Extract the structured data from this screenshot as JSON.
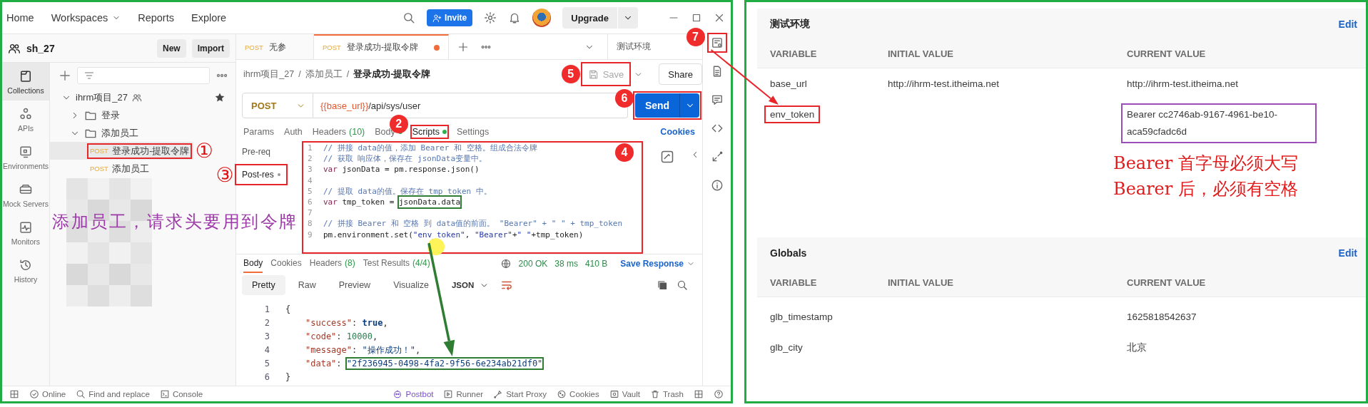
{
  "top_bar": {
    "nav": [
      {
        "label": "Home",
        "dropdown": false
      },
      {
        "label": "Workspaces",
        "dropdown": true
      },
      {
        "label": "Reports",
        "dropdown": false
      },
      {
        "label": "Explore",
        "dropdown": false
      }
    ],
    "invite": "Invite",
    "upgrade": "Upgrade"
  },
  "workspace": {
    "name": "sh_27",
    "buttons": [
      "New",
      "Import"
    ]
  },
  "rail": [
    {
      "label": "Collections",
      "kind": "collections",
      "selected": true
    },
    {
      "label": "APIs",
      "kind": "apis",
      "selected": false
    },
    {
      "label": "Environments",
      "kind": "environments",
      "selected": false
    },
    {
      "label": "Mock Servers",
      "kind": "mock",
      "selected": false
    },
    {
      "label": "Monitors",
      "kind": "monitors",
      "selected": false
    },
    {
      "label": "History",
      "kind": "history",
      "selected": false
    }
  ],
  "tree": [
    {
      "kind": "collection",
      "label": "ihrm项目_27",
      "expanded": true,
      "starred": true,
      "children": [
        {
          "kind": "folder",
          "label": "登录",
          "expanded": false
        },
        {
          "kind": "folder",
          "label": "添加员工",
          "expanded": true,
          "children": [
            {
              "kind": "request",
              "method": "POST",
              "label": "登录成功-提取令牌",
              "selected": true,
              "boxed": true,
              "marker": {
                "kind": "circled",
                "text": "①"
              }
            },
            {
              "kind": "request",
              "method": "POST",
              "label": "添加员工",
              "selected": false,
              "boxed": false
            }
          ]
        }
      ]
    }
  ],
  "note": "添加员工，请求头要用到令牌",
  "tabs": [
    {
      "method": "POST",
      "label": "无参",
      "selected": false,
      "unsaved": false
    },
    {
      "method": "POST",
      "label": "登录成功-提取令牌",
      "selected": true,
      "unsaved": true
    }
  ],
  "environment": "测试环境",
  "breadcrumb": {
    "items": [
      "ihrm项目_27",
      "添加员工",
      "登录成功-提取令牌"
    ],
    "separator": "/"
  },
  "request": {
    "method": "POST",
    "url_variable": "{{base_url}}",
    "url_path": "/api/sys/user",
    "save": {
      "label": "Save",
      "boxed": true,
      "marker": {
        "kind": "badge",
        "text": "5"
      }
    },
    "share": "Share",
    "send": {
      "label": "Send",
      "boxed": true,
      "marker": {
        "kind": "badge",
        "text": "6"
      }
    }
  },
  "request_tabs": [
    {
      "label": "Params",
      "selected": false,
      "dot": false,
      "boxed": false
    },
    {
      "label": "Auth",
      "selected": false,
      "dot": false,
      "boxed": false
    },
    {
      "label": "Headers",
      "count": "(10)",
      "selected": false,
      "dot": false,
      "boxed": false
    },
    {
      "label": "Body",
      "selected": false,
      "dot": true,
      "boxed": false
    },
    {
      "label": "Scripts",
      "selected": true,
      "dot": true,
      "boxed": true,
      "marker": {
        "kind": "badge",
        "text": "2"
      }
    },
    {
      "label": "Settings",
      "selected": false,
      "dot": false,
      "boxed": false
    }
  ],
  "cookies_link": "Cookies",
  "script_tabs": [
    {
      "label": "Pre-req",
      "selected": false,
      "dot": false,
      "boxed": false
    },
    {
      "label": "Post-res",
      "selected": true,
      "dot": true,
      "boxed": true,
      "marker": {
        "kind": "circled",
        "text": "③"
      }
    }
  ],
  "script": {
    "boxed": true,
    "marker": {
      "kind": "badge",
      "text": "4"
    },
    "lines": [
      {
        "number": "1",
        "segments": [
          {
            "kind": "comment",
            "text": "// 拼接 data的值，添加 Bearer 和 空格。组成合法令牌",
            "boxed": false
          }
        ]
      },
      {
        "number": "2",
        "segments": [
          {
            "kind": "comment",
            "text": "// 获取 响应体，保存在 jsonData变量中。",
            "boxed": false
          }
        ]
      },
      {
        "number": "3",
        "segments": [
          {
            "kind": "keyword",
            "text": "var",
            "boxed": false
          },
          {
            "kind": "plain",
            "text": " jsonData = pm.response.json()",
            "boxed": false
          }
        ]
      },
      {
        "number": "4"
      },
      {
        "number": "5",
        "segments": [
          {
            "kind": "comment",
            "text": "// 提取 data的值。保存在 tmp_token 中。",
            "boxed": false
          }
        ]
      },
      {
        "number": "6",
        "segments": [
          {
            "kind": "keyword",
            "text": "var",
            "boxed": false
          },
          {
            "kind": "plain",
            "text": " tmp_token = ",
            "boxed": false
          },
          {
            "kind": "plain",
            "text": "jsonData.data",
            "boxed": true
          }
        ]
      },
      {
        "number": "7"
      },
      {
        "number": "8",
        "segments": [
          {
            "kind": "comment",
            "text": "// 拼接 Bearer 和 空格 到 data值的前面。 \"Bearer\" + \" \" + tmp_token",
            "boxed": false
          }
        ]
      },
      {
        "number": "9",
        "segments": [
          {
            "kind": "plain",
            "text": "pm.environment.set(",
            "boxed": false
          },
          {
            "kind": "string",
            "text": "\"env_token\"",
            "boxed": false
          },
          {
            "kind": "plain",
            "text": ", ",
            "boxed": false
          },
          {
            "kind": "string",
            "text": "\"Bearer\"",
            "boxed": false
          },
          {
            "kind": "plain",
            "text": "+",
            "boxed": false
          },
          {
            "kind": "string",
            "text": "\" \"",
            "boxed": false
          },
          {
            "kind": "plain",
            "text": "+tmp_token)",
            "boxed": false
          }
        ]
      }
    ]
  },
  "response": {
    "tabs": [
      {
        "label": "Body",
        "selected": true
      },
      {
        "label": "Cookies",
        "selected": false
      },
      {
        "label": "Headers",
        "count": "(8)",
        "selected": false
      },
      {
        "label": "Test Results",
        "count": "(4/4)",
        "selected": false
      }
    ],
    "status": "200 OK",
    "time": "38 ms",
    "size": "410 B",
    "save_response": "Save Response",
    "views": [
      {
        "label": "Pretty",
        "selected": true
      },
      {
        "label": "Raw",
        "selected": false
      },
      {
        "label": "Preview",
        "selected": false
      },
      {
        "label": "Visualize",
        "selected": false
      }
    ],
    "format": "JSON",
    "lines": [
      {
        "number": "1",
        "indented": false,
        "segments": [
          {
            "kind": "punct",
            "text": "{",
            "boxed": false
          }
        ]
      },
      {
        "number": "2",
        "indented": true,
        "segments": [
          {
            "kind": "key",
            "text": "\"success\"",
            "boxed": false
          },
          {
            "kind": "punct",
            "text": ": ",
            "boxed": false
          },
          {
            "kind": "bool",
            "text": "true",
            "boxed": false
          },
          {
            "kind": "punct",
            "text": ",",
            "boxed": false
          }
        ]
      },
      {
        "number": "3",
        "indented": true,
        "segments": [
          {
            "kind": "key",
            "text": "\"code\"",
            "boxed": false
          },
          {
            "kind": "punct",
            "text": ": ",
            "boxed": false
          },
          {
            "kind": "number",
            "text": "10000",
            "boxed": false
          },
          {
            "kind": "punct",
            "text": ",",
            "boxed": false
          }
        ]
      },
      {
        "number": "4",
        "indented": true,
        "segments": [
          {
            "kind": "key",
            "text": "\"message\"",
            "boxed": false
          },
          {
            "kind": "punct",
            "text": ": ",
            "boxed": false
          },
          {
            "kind": "string",
            "text": "\"操作成功！\"",
            "boxed": false
          },
          {
            "kind": "punct",
            "text": ",",
            "boxed": false
          }
        ]
      },
      {
        "number": "5",
        "indented": true,
        "segments": [
          {
            "kind": "key",
            "text": "\"data\"",
            "boxed": false
          },
          {
            "kind": "punct",
            "text": ": ",
            "boxed": false
          },
          {
            "kind": "string",
            "text": "\"2f236945-0498-4fa2-9f56-6e234ab21df0\"",
            "boxed": true
          }
        ]
      },
      {
        "number": "6",
        "indented": false,
        "segments": [
          {
            "kind": "punct",
            "text": "}",
            "boxed": false
          }
        ]
      }
    ]
  },
  "right_rail": {
    "boxed": true,
    "marker": {
      "kind": "badge",
      "text": "7"
    }
  },
  "status_bar": {
    "left": [
      {
        "kind": "online",
        "label": "Online"
      },
      {
        "kind": "find",
        "label": "Find and replace"
      },
      {
        "kind": "console",
        "label": "Console"
      }
    ],
    "right": [
      {
        "kind": "postbot",
        "label": "Postbot"
      },
      {
        "kind": "runner",
        "label": "Runner"
      },
      {
        "kind": "proxy",
        "label": "Start Proxy"
      },
      {
        "kind": "cookie",
        "label": "Cookies"
      },
      {
        "kind": "vault",
        "label": "Vault"
      },
      {
        "kind": "trash",
        "label": "Trash"
      }
    ]
  },
  "env_panel": {
    "sections": [
      {
        "title": "测试环境",
        "edit": "Edit",
        "columns": [
          "VARIABLE",
          "INITIAL VALUE",
          "CURRENT VALUE"
        ],
        "rows": [
          {
            "variable": "base_url",
            "initial": "http://ihrm-test.itheima.net",
            "current": "http://ihrm-test.itheima.net",
            "variable_boxed": false,
            "current_boxed": false
          },
          {
            "variable": "env_token",
            "current": "Bearer cc2746ab-9167-4961-be10-aca59cfadc6d",
            "variable_boxed": true,
            "current_boxed": true
          }
        ]
      },
      {
        "title": "Globals",
        "edit": "Edit",
        "columns": [
          "VARIABLE",
          "INITIAL VALUE",
          "CURRENT VALUE"
        ],
        "rows": [
          {
            "variable": "glb_timestamp",
            "current": "1625818542637",
            "variable_boxed": false,
            "current_boxed": false
          },
          {
            "variable": "glb_city",
            "current": "北京",
            "variable_boxed": false,
            "current_boxed": false
          }
        ]
      }
    ],
    "warnings": [
      "Bearer 首字母必须大写",
      "Bearer 后，必须有空格"
    ]
  }
}
